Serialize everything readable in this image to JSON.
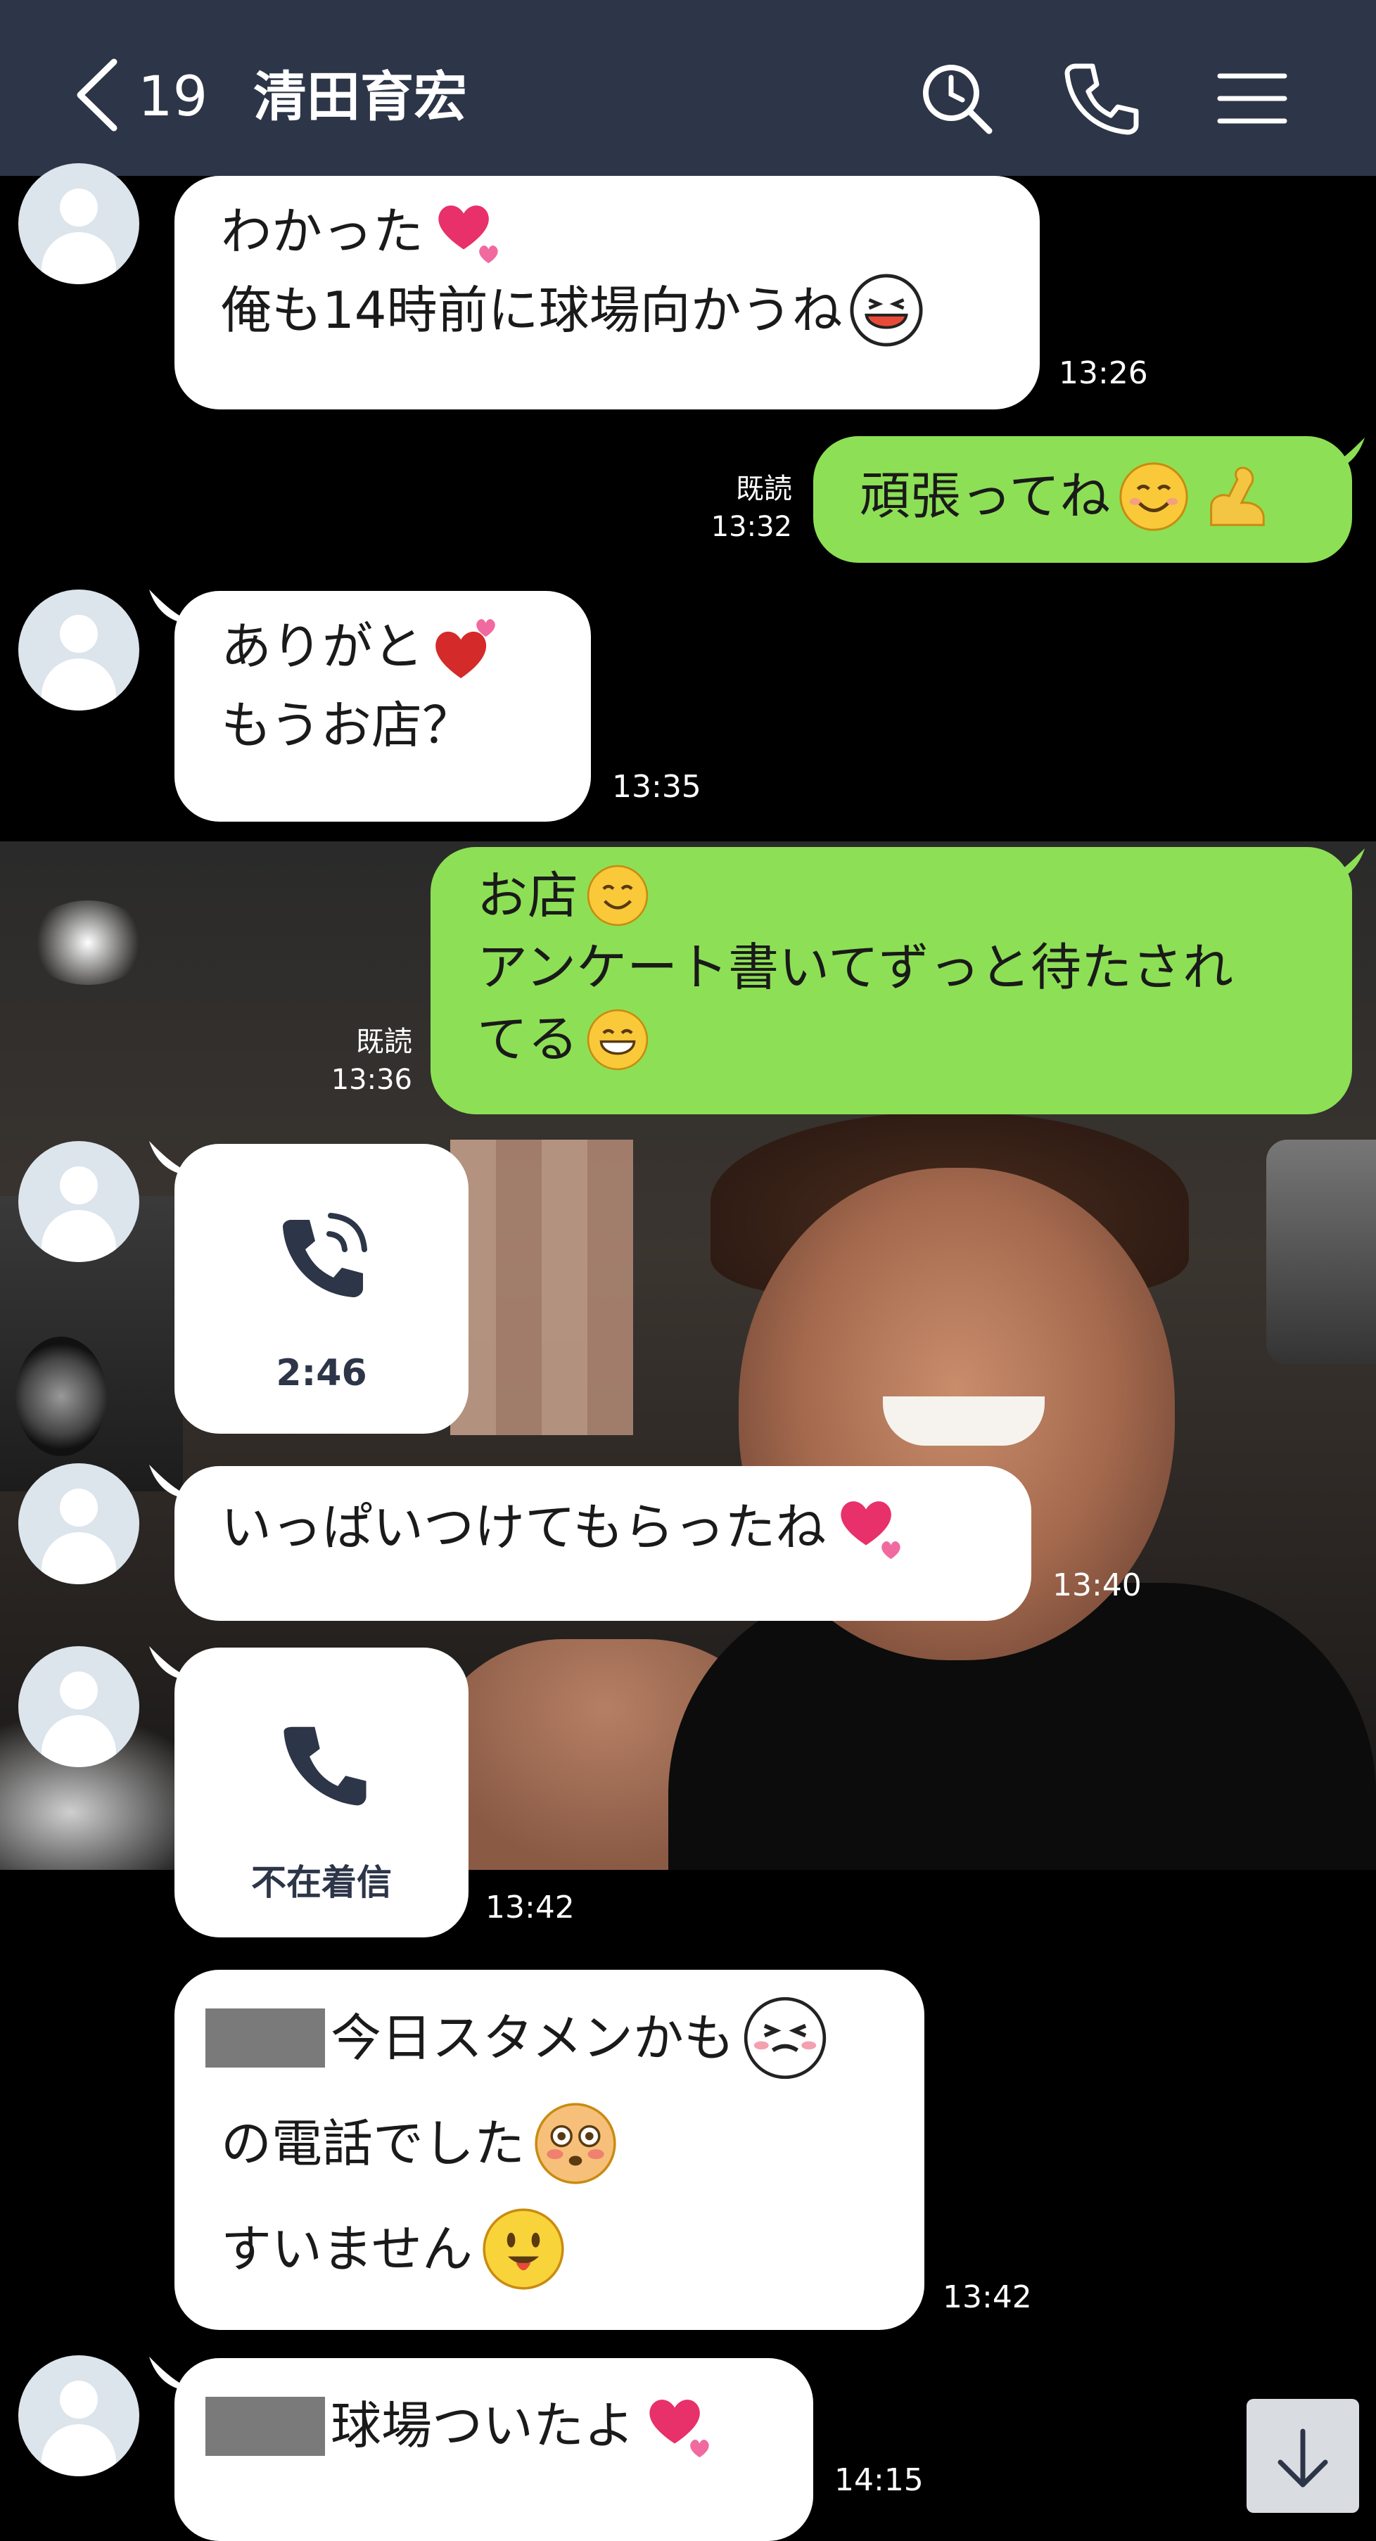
{
  "header": {
    "back_count": "19",
    "title": "清田育宏",
    "icons": [
      "back-chevron-icon",
      "search-icon",
      "phone-icon",
      "menu-icon"
    ]
  },
  "messages": {
    "m1": {
      "line1": "わかった",
      "line2": "俺も14時前に球場向かうね",
      "time": "13:26"
    },
    "m2": {
      "text": "頑張ってね",
      "read": "既読",
      "time": "13:32"
    },
    "m3": {
      "line1": "ありがと",
      "line2": "もうお店？",
      "time": "13:35"
    },
    "m4": {
      "line1": "お店",
      "line2": "アンケート書いてずっと待たされ",
      "line3": "てる",
      "read": "既読",
      "time": "13:36"
    },
    "m5": {
      "call_duration": "2:46"
    },
    "m6": {
      "text": "いっぱいつけてもらったね",
      "time": "13:40"
    },
    "m7": {
      "call_label": "不在着信",
      "time": "13:42"
    },
    "m8": {
      "line1": "今日スタメンかも",
      "line2": "の電話でした",
      "line3": "すいません",
      "time": "13:42"
    },
    "m9": {
      "text": "球場ついたよ",
      "time": "14:15"
    }
  },
  "colors": {
    "header_bg": "#2d3548",
    "chat_bg": "#000000",
    "incoming_bubble": "#ffffff",
    "outgoing_bubble": "#8de055",
    "accent_icon": "#2d3548"
  }
}
